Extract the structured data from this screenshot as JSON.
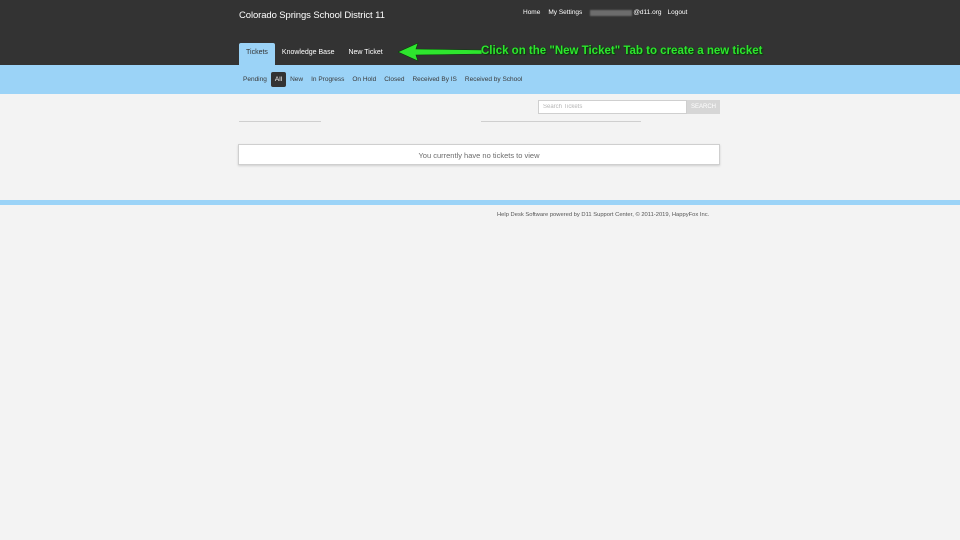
{
  "header": {
    "brand": "Colorado Springs School District 11",
    "nav": {
      "home": "Home",
      "settings": "My Settings",
      "email_domain": "@d11.org",
      "logout": "Logout"
    }
  },
  "tabs": [
    {
      "label": "Tickets",
      "active": true
    },
    {
      "label": "Knowledge Base",
      "active": false
    },
    {
      "label": "New Ticket",
      "active": false
    }
  ],
  "annotation": {
    "text": "Click on the \"New Ticket\" Tab to create a new ticket",
    "color": "#2ee52e"
  },
  "filters": [
    {
      "label": "Pending",
      "active": false
    },
    {
      "label": "All",
      "active": true
    },
    {
      "label": "New",
      "active": false
    },
    {
      "label": "In Progress",
      "active": false
    },
    {
      "label": "On Hold",
      "active": false
    },
    {
      "label": "Closed",
      "active": false
    },
    {
      "label": "Received By IS",
      "active": false
    },
    {
      "label": "Received by School",
      "active": false
    }
  ],
  "search": {
    "placeholder": "Search Tickets",
    "button_label": "SEARCH"
  },
  "empty_message": "You currently have no tickets to view",
  "footer": {
    "text": "Help Desk Software powered by D11 Support Center, © 2011-2019, HappyFox Inc."
  },
  "colors": {
    "topbar": "#333333",
    "accent": "#9bd3f7",
    "background": "#f3f3f3"
  }
}
